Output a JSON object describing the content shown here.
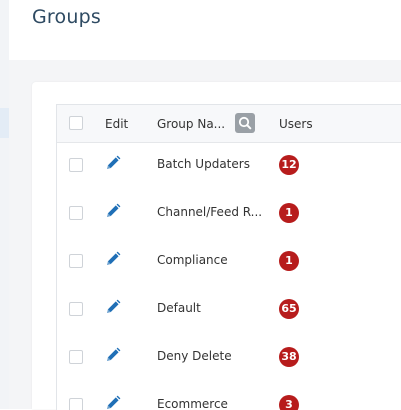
{
  "page": {
    "title": "Groups"
  },
  "table": {
    "headers": {
      "edit": "Edit",
      "group_name": "Group Na...",
      "users": "Users"
    },
    "icons": {
      "search": "search-icon",
      "edit": "pencil-icon"
    },
    "rows": [
      {
        "name": "Batch Updaters",
        "users": "12"
      },
      {
        "name": "Channel/Feed R...",
        "users": "1"
      },
      {
        "name": "Compliance",
        "users": "1"
      },
      {
        "name": "Default",
        "users": "65"
      },
      {
        "name": "Deny Delete",
        "users": "38"
      },
      {
        "name": "Ecommerce",
        "users": "3"
      }
    ]
  },
  "colors": {
    "title": "#2e4a62",
    "badge": "#b71c1c",
    "pencil": "#1f6fb6"
  }
}
